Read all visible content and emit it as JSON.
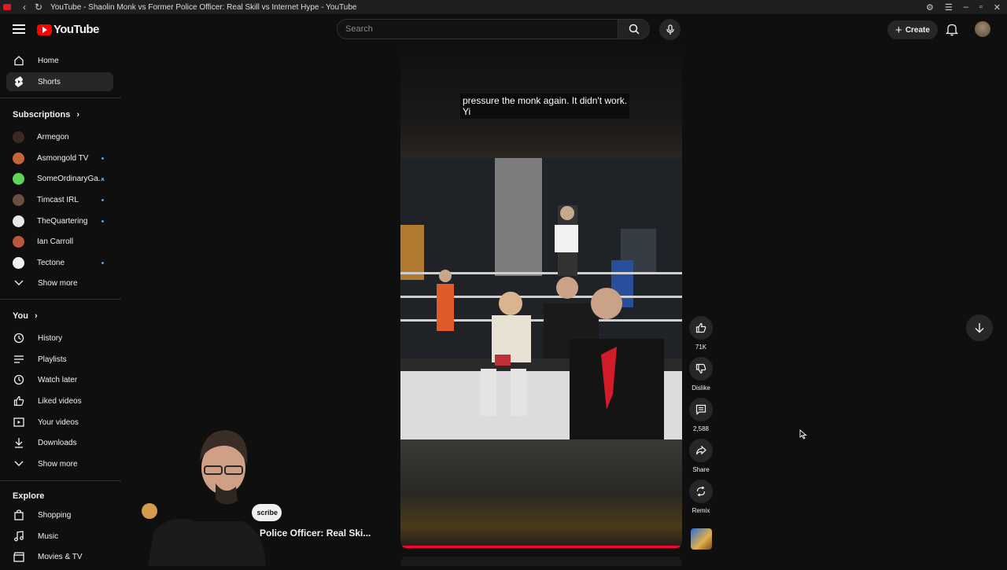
{
  "window": {
    "title": "YouTube - Shaolin Monk vs Former Police Officer: Real Skill vs Internet Hype - YouTube"
  },
  "masthead": {
    "logo_text": "YouTube",
    "search_placeholder": "Search",
    "create_label": "Create"
  },
  "sidebar": {
    "main": [
      {
        "label": "Home",
        "icon": "home-icon"
      },
      {
        "label": "Shorts",
        "icon": "shorts-icon",
        "active": true
      }
    ],
    "subscriptions_heading": "Subscriptions",
    "subscriptions": [
      {
        "label": "Armegon",
        "color": "#3a2a20",
        "new": false
      },
      {
        "label": "Asmongold TV",
        "color": "#c4663a",
        "new": true
      },
      {
        "label": "SomeOrdinaryGa...",
        "color": "#5fd35a",
        "new": true
      },
      {
        "label": "Timcast IRL",
        "color": "#6a5040",
        "new": true
      },
      {
        "label": "TheQuartering",
        "color": "#e8e8e8",
        "new": true
      },
      {
        "label": "Ian Carroll",
        "color": "#b8573a",
        "new": false
      },
      {
        "label": "Tectone",
        "color": "#f0f0f0",
        "new": true
      }
    ],
    "subs_show_more": "Show more",
    "you_heading": "You",
    "you_items": [
      {
        "label": "History",
        "icon": "history-icon"
      },
      {
        "label": "Playlists",
        "icon": "playlists-icon"
      },
      {
        "label": "Watch later",
        "icon": "clock-icon"
      },
      {
        "label": "Liked videos",
        "icon": "thumbs-up-icon"
      },
      {
        "label": "Your videos",
        "icon": "your-videos-icon"
      },
      {
        "label": "Downloads",
        "icon": "download-icon"
      }
    ],
    "you_show_more": "Show more",
    "explore_heading": "Explore",
    "explore_items": [
      {
        "label": "Shopping",
        "icon": "shopping-bag-icon"
      },
      {
        "label": "Music",
        "icon": "music-icon"
      },
      {
        "label": "Movies & TV",
        "icon": "clapperboard-icon"
      }
    ]
  },
  "player": {
    "caption_line1": "pressure the monk again. It didn't work.",
    "caption_line2": "Yi",
    "progress": 0.99
  },
  "actions": {
    "like_count": "71K",
    "dislike_label": "Dislike",
    "comment_count": "2,588",
    "share_label": "Share",
    "remix_label": "Remix"
  },
  "overlay": {
    "subscribe_label": "scribe",
    "short_title": "Police Officer: Real Ski..."
  },
  "colors": {
    "accent": "#ff0033",
    "unread_dot": "#3ea6ff",
    "background": "#0f0f0f"
  }
}
